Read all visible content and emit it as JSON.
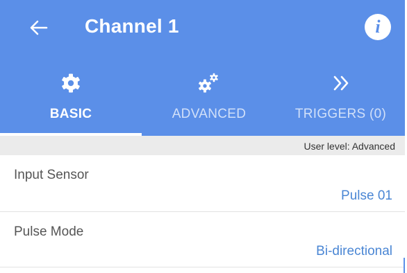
{
  "app_bar": {
    "title": "Channel 1",
    "back_icon": "arrow-left-icon",
    "info_icon": "info-icon",
    "info_glyph": "i"
  },
  "tabs": [
    {
      "label": "BASIC",
      "icon": "gear-icon",
      "active": true
    },
    {
      "label": "ADVANCED",
      "icon": "gears-icon",
      "active": false
    },
    {
      "label": "TRIGGERS (0)",
      "icon": "double-chevron-right-icon",
      "active": false
    }
  ],
  "user_level": "User level: Advanced",
  "settings": [
    {
      "label": "Input Sensor",
      "value": "Pulse 01"
    },
    {
      "label": "Pulse Mode",
      "value": "Bi-directional"
    }
  ],
  "colors": {
    "primary": "#5b8fe8",
    "value_text": "#4a86d4",
    "subheader_bg": "#ebebeb"
  }
}
